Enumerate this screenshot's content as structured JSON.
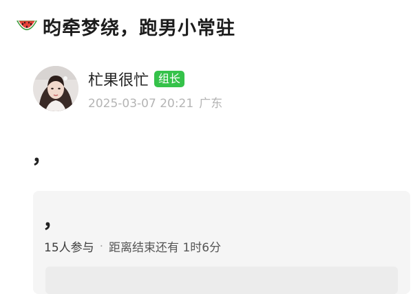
{
  "post": {
    "title_icon": "watermelon-icon",
    "title": "昀牵梦绕，跑男小常驻",
    "author": {
      "name": "杧果很忙",
      "role_badge": "组长",
      "timestamp": "2025-03-07 20:21",
      "location": "广东"
    },
    "body": "，"
  },
  "poll": {
    "question": "，",
    "participants": "15人参与",
    "separator": "·",
    "countdown": "距离结束还有 1时6分"
  },
  "colors": {
    "badge_green": "#35c24a",
    "meta_gray": "#b4b4b4",
    "card_bg": "#f5f5f5"
  }
}
